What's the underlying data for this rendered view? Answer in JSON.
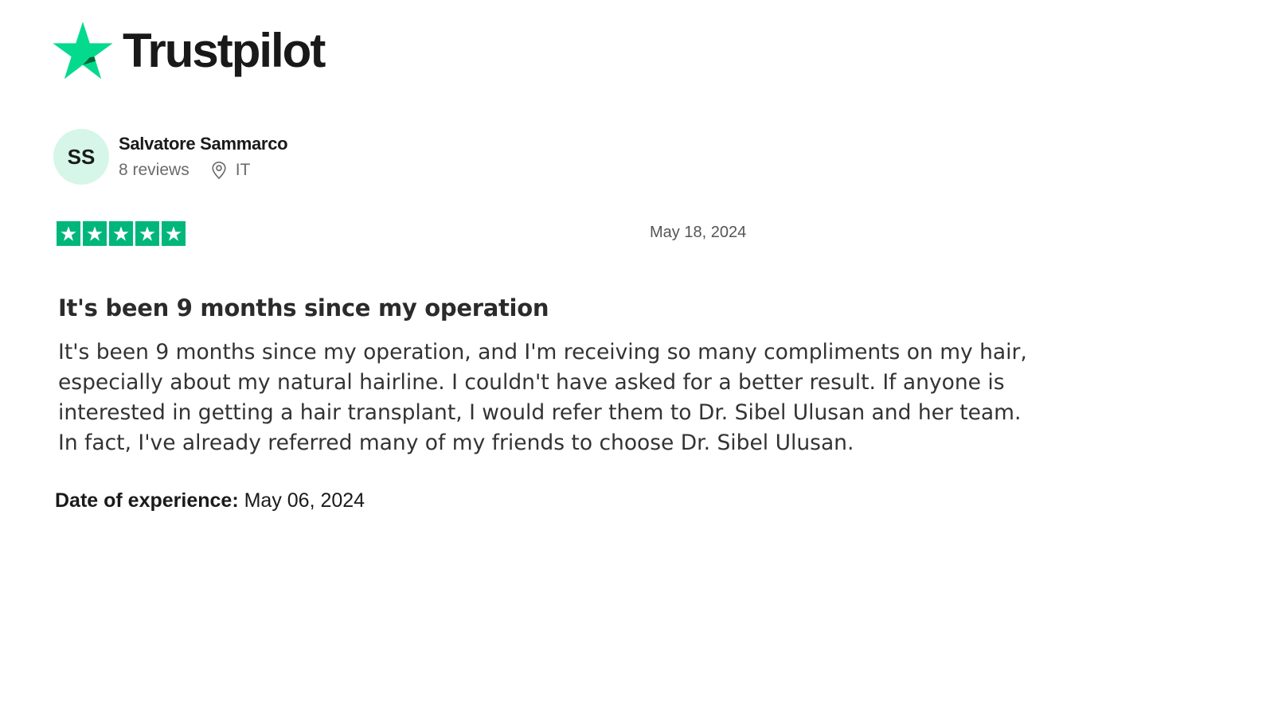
{
  "brand": {
    "logo_text": "Trustpilot",
    "star_icon": "trustpilot-star-icon",
    "color": "#00b67a",
    "logo_star_color": "#04da8d"
  },
  "reviewer": {
    "initials": "SS",
    "name": "Salvatore Sammarco",
    "reviews_count": "8 reviews",
    "location_icon": "map-pin-icon",
    "country": "IT",
    "avatar_color": "#d5f6e8"
  },
  "review": {
    "rating": 5,
    "rating_max": 5,
    "date": "May 18, 2024",
    "title": "It's been 9 months since my operation",
    "body_lines": [
      "It's been 9 months since my operation, and I'm receiving so many compliments on my hair,",
      "especially about my natural hairline. I couldn't have asked for a better result. If anyone is",
      "interested in getting a hair transplant, I would refer them to Dr. Sibel Ulusan and her team.",
      "In fact, I've already referred many of my friends to choose Dr. Sibel Ulusan."
    ],
    "experience_label": "Date of experience:",
    "experience_date": "May 06, 2024"
  }
}
